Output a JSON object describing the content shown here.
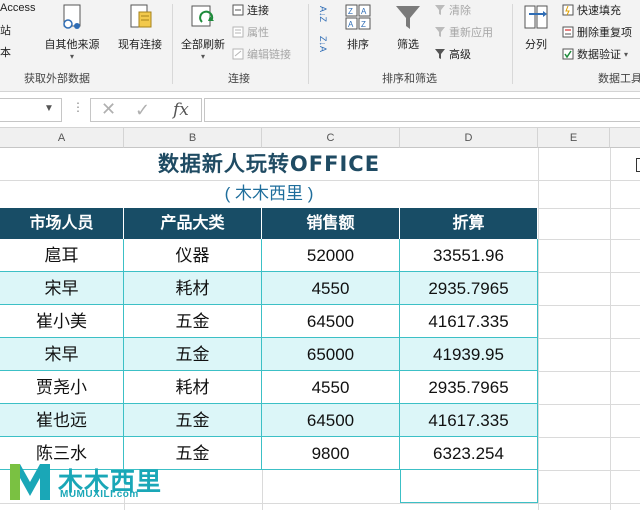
{
  "ribbon": {
    "left_partial": {
      "access": "Access",
      "zhan": "站",
      "ben": "本"
    },
    "other_sources": "自其他来源",
    "existing_conn": "现有连接",
    "refresh_all": "全部刷新",
    "connections": "连接",
    "properties": "属性",
    "edit_links": "编辑链接",
    "sort_az": "A↓Z",
    "sort_za": "Z↓A",
    "sort": "排序",
    "filter": "筛选",
    "clear": "清除",
    "reapply": "重新应用",
    "advanced": "高级",
    "text_to_columns": "分列",
    "flash_fill": "快速填充",
    "remove_duplicates": "删除重复项",
    "data_validation": "数据验证",
    "groups": {
      "get_external": "获取外部数据",
      "connections": "连接",
      "sort_filter": "排序和筛选",
      "data_tools": "数据工具"
    }
  },
  "formula_bar": {
    "fx": "fx",
    "cancel": "✕",
    "enter": "✓",
    "name_box": "",
    "formula": ""
  },
  "columns": [
    "A",
    "B",
    "C",
    "D",
    "E"
  ],
  "sheet": {
    "title": "数据新人玩转OFFICE",
    "subtitle": "( 木木西里 )",
    "headers": [
      "市场人员",
      "产品大类",
      "销售额",
      "折算"
    ],
    "rows": [
      [
        "扈耳",
        "仪器",
        "52000",
        "33551.96"
      ],
      [
        "宋早",
        "耗材",
        "4550",
        "2935.7965"
      ],
      [
        "崔小美",
        "五金",
        "64500",
        "41617.335"
      ],
      [
        "宋早",
        "五金",
        "65000",
        "41939.95"
      ],
      [
        "贾尧小",
        "耗材",
        "4550",
        "2935.7965"
      ],
      [
        "崔也远",
        "五金",
        "64500",
        "41617.335"
      ],
      [
        "陈三水",
        "五金",
        "9800",
        "6323.254"
      ]
    ]
  },
  "watermark": {
    "name": "木木西里",
    "url": "MUMUXILI.com"
  },
  "colors": {
    "header_bg": "#184d66",
    "alt_row_bg": "#dcf6f8",
    "border": "#3cc0c6",
    "title": "#1f4b63",
    "logo": "#1aa7b7"
  }
}
